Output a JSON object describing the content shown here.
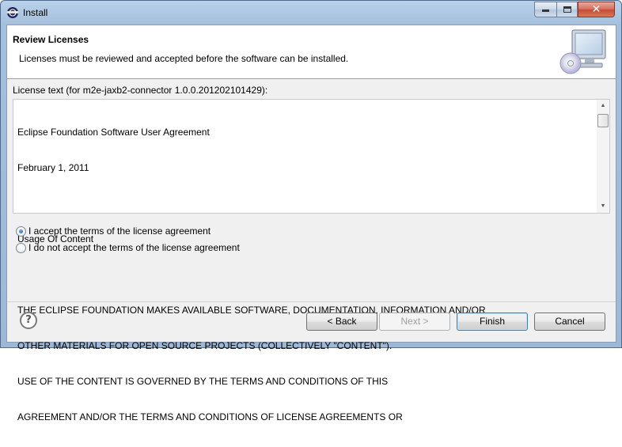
{
  "window": {
    "title": "Install"
  },
  "header": {
    "title": "Review Licenses",
    "description": "Licenses must be reviewed and accepted before the software can be installed.",
    "image_icon": "computer-cd-icon"
  },
  "license": {
    "label": "License text (for m2e-jaxb2-connector 1.0.0.201202101429):",
    "lines": [
      "Eclipse Foundation Software User Agreement",
      "February 1, 2011",
      "",
      "Usage Of Content",
      "",
      "THE ECLIPSE FOUNDATION MAKES AVAILABLE SOFTWARE, DOCUMENTATION, INFORMATION AND/OR",
      "OTHER MATERIALS FOR OPEN SOURCE PROJECTS (COLLECTIVELY \"CONTENT\").",
      "USE OF THE CONTENT IS GOVERNED BY THE TERMS AND CONDITIONS OF THIS",
      "AGREEMENT AND/OR THE TERMS AND CONDITIONS OF LICENSE AGREEMENTS OR"
    ]
  },
  "options": {
    "accept": {
      "label": "I accept the terms of the license agreement",
      "checked": true
    },
    "decline": {
      "label": "I do not accept the terms of the license agreement",
      "checked": false
    }
  },
  "footer": {
    "help_icon": "help-icon",
    "back_label": "< Back",
    "next_label": "Next >",
    "finish_label": "Finish",
    "cancel_label": "Cancel"
  }
}
